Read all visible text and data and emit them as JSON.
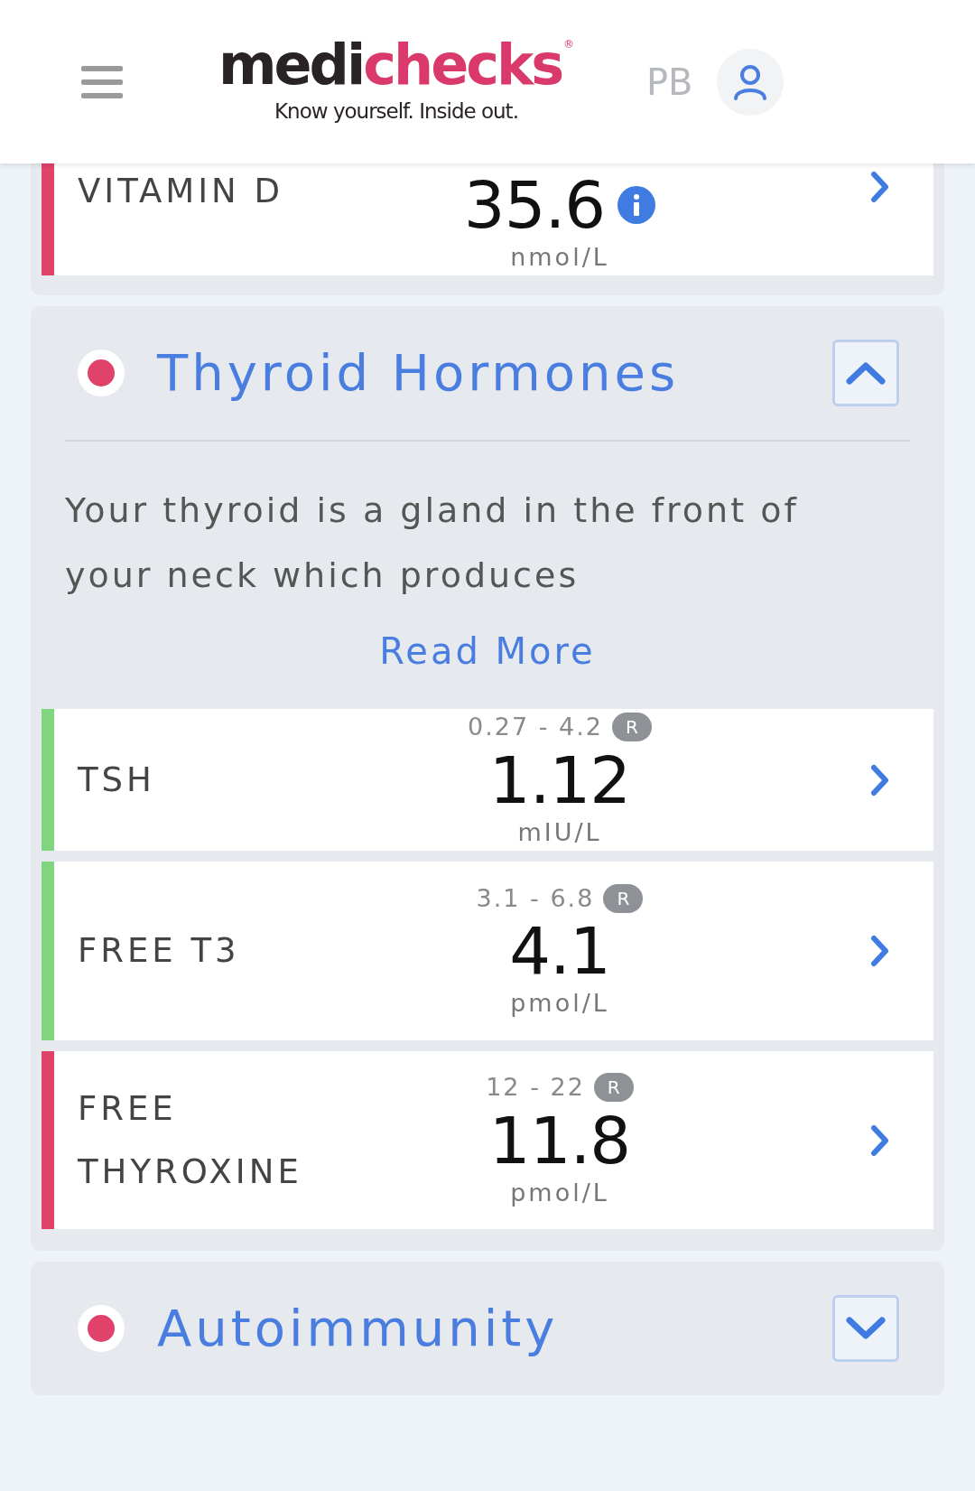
{
  "header": {
    "logo": {
      "part_1": "medi",
      "part_2": "checks",
      "mark": "®",
      "tagline": "Know yourself. Inside out."
    },
    "initials": "PB"
  },
  "sections": [
    {
      "kind": "partial",
      "results": [
        {
          "name": "VITAMIN D",
          "value": "35.6",
          "unit": "nmol/L",
          "info": true,
          "color": "#e0426a"
        }
      ]
    },
    {
      "kind": "section",
      "title": "Thyroid Hormones",
      "color": "#e0426a",
      "expanded": true,
      "description": "Your thyroid is a gland in the front of your neck which produces",
      "read_more": "Read More",
      "results": [
        {
          "name": "TSH",
          "range": "0.27 - 4.2",
          "badge": "R",
          "value": "1.12",
          "unit": "mIU/L",
          "color": "#7fd67f"
        },
        {
          "name": "FREE T3",
          "range": "3.1 - 6.8",
          "badge": "R",
          "value": "4.1",
          "unit": "pmol/L",
          "color": "#7fd67f"
        },
        {
          "name": "FREE THYROXINE",
          "range": "12 - 22",
          "badge": "R",
          "value": "11.8",
          "unit": "pmol/L",
          "color": "#e0426a"
        }
      ]
    },
    {
      "kind": "section",
      "title": "Autoimmunity",
      "color": "#e0426a",
      "expanded": false
    }
  ]
}
